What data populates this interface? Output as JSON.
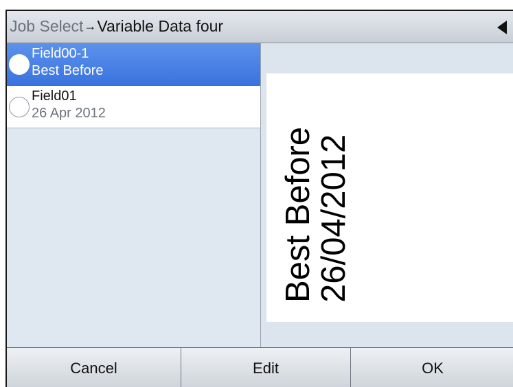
{
  "header": {
    "breadcrumb_parent": "Job Select",
    "breadcrumb_separator": "→",
    "breadcrumb_current": "Variable Data four",
    "back_icon": "triangle-left"
  },
  "fields": [
    {
      "title": "Field00-1",
      "subtitle": "Best Before",
      "selected": true
    },
    {
      "title": "Field01",
      "subtitle": "26 Apr 2012",
      "selected": false
    }
  ],
  "preview": {
    "line1": "Best Before",
    "line2": "26/04/2012"
  },
  "footer": {
    "cancel_label": "Cancel",
    "edit_label": "Edit",
    "ok_label": "OK"
  },
  "colors": {
    "selection": "#3a73de",
    "panel_bg": "#dfe8f1"
  }
}
